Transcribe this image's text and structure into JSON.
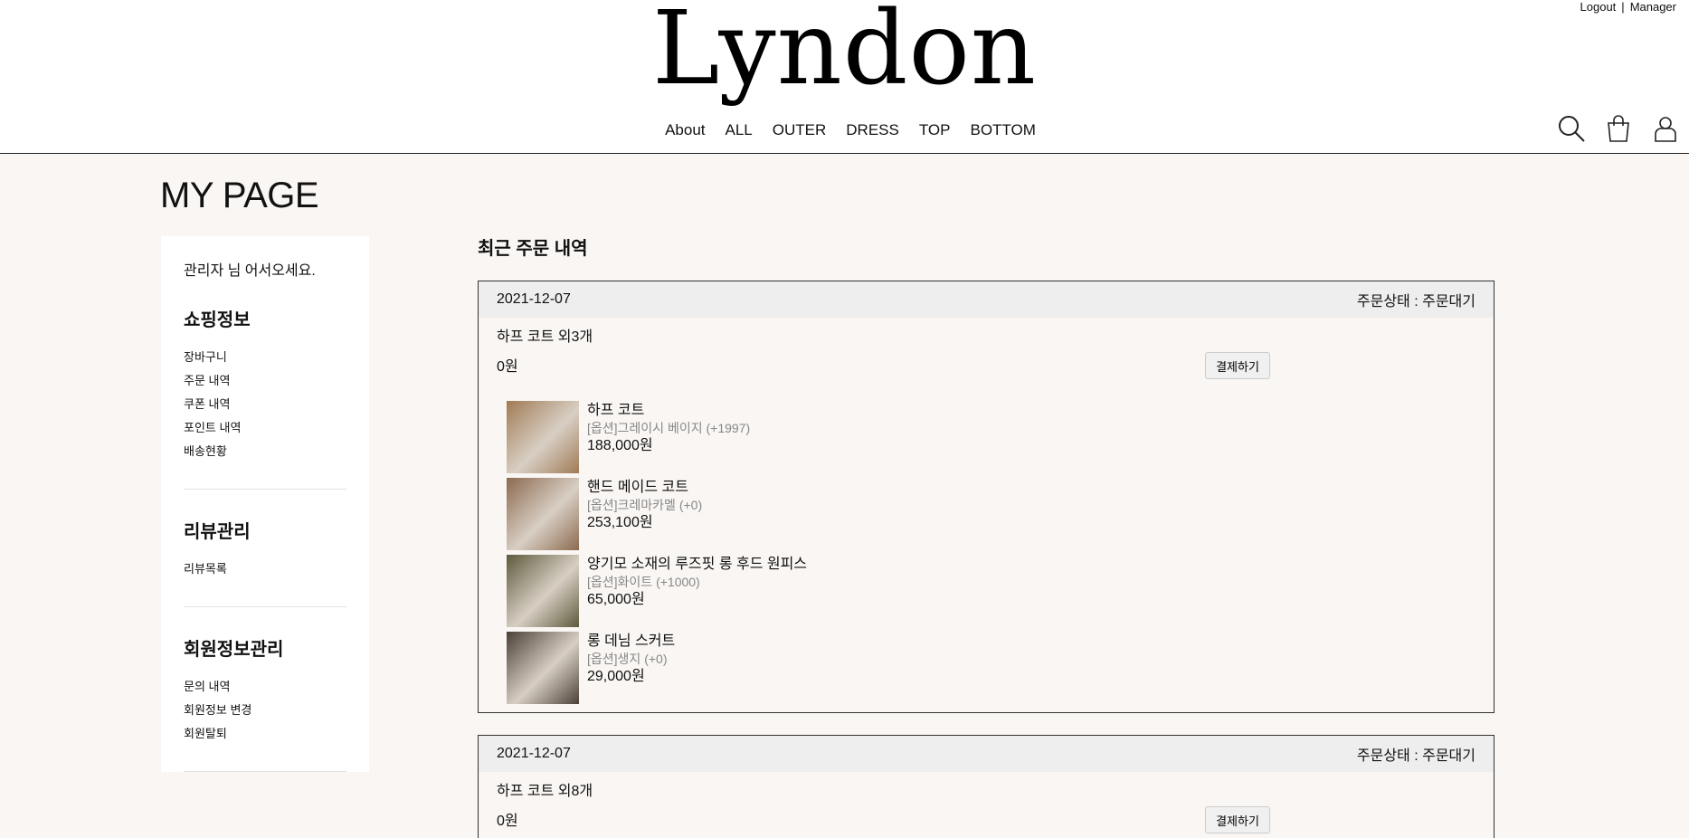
{
  "header": {
    "logo": "Lyndon",
    "toplinks": [
      "Logout",
      "|",
      "Manager"
    ],
    "nav": [
      "About",
      "ALL",
      "OUTER",
      "DRESS",
      "TOP",
      "BOTTOM"
    ],
    "icons": [
      "search-icon",
      "shopping-bag-icon",
      "user-icon"
    ]
  },
  "page_title": "MY PAGE",
  "sidebar": {
    "welcome": "관리자 님 어서오세요.",
    "sections": [
      {
        "title": "쇼핑정보",
        "items": [
          "장바구니",
          "주문 내역",
          "쿠폰 내역",
          "포인트 내역",
          "배송현황"
        ]
      },
      {
        "title": "리뷰관리",
        "items": [
          "리뷰목록"
        ]
      },
      {
        "title": "회원정보관리",
        "items": [
          "문의 내역",
          "회원정보 변경",
          "회원탈퇴"
        ]
      }
    ]
  },
  "main": {
    "section_title": "최근 주문 내역",
    "orders": [
      {
        "date": "2021-12-07",
        "status": "주문상태 : 주문대기",
        "name": "하프 코트 외3개",
        "price": "0원",
        "pay_label": "결제하기",
        "items": [
          {
            "name": "하프 코트",
            "option": "[옵션]그레이시 베이지 (+1997)",
            "price": "188,000원",
            "thumb_color": "#a07b55"
          },
          {
            "name": "핸드 메이드 코트",
            "option": "[옵션]크레마카멜 (+0)",
            "price": "253,100원",
            "thumb_color": "#8c6a50"
          },
          {
            "name": "양기모 소재의 루즈핏 롱 후드 원피스",
            "option": "[옵션]화이트 (+1000)",
            "price": "65,000원",
            "thumb_color": "#5d5a3c"
          },
          {
            "name": "롱 데님 스커트",
            "option": "[옵션]생지 (+0)",
            "price": "29,000원",
            "thumb_color": "#4a4038"
          }
        ]
      },
      {
        "date": "2021-12-07",
        "status": "주문상태 : 주문대기",
        "name": "하프 코트 외8개",
        "price": "0원",
        "pay_label": "결제하기"
      }
    ]
  }
}
